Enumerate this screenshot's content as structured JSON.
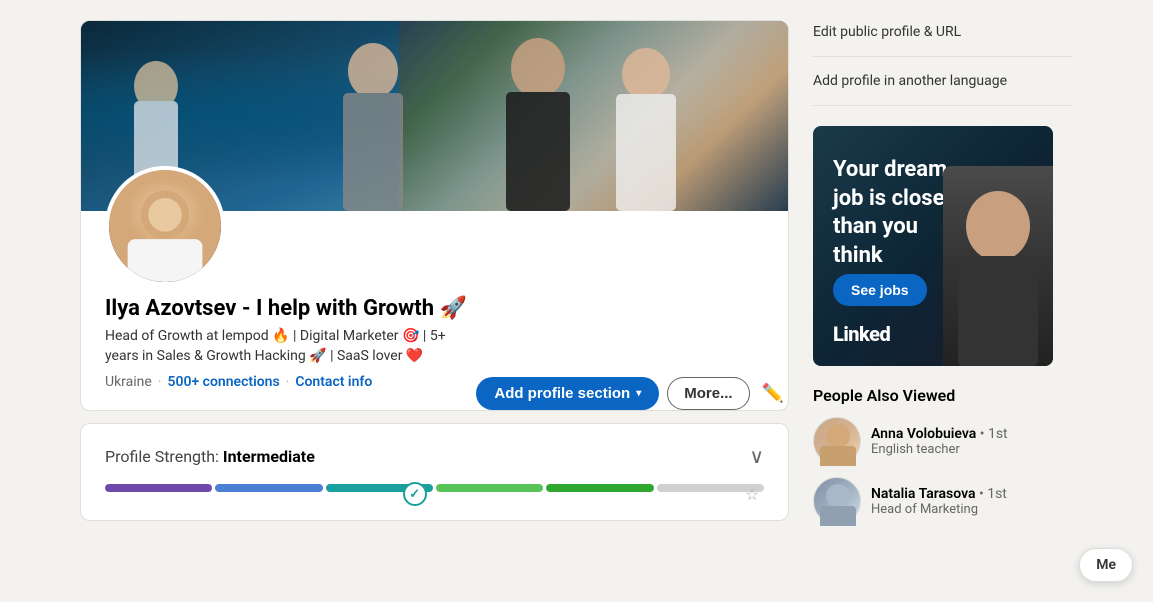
{
  "sidebar": {
    "edit_profile_link": "Edit public profile & URL",
    "add_language_link": "Add profile in another language"
  },
  "ad": {
    "text": "Your dream job is closer than you think",
    "button_label": "See jobs",
    "logo": "Linked"
  },
  "people_also_viewed": {
    "title": "People Also Viewed",
    "people": [
      {
        "name": "Anna Volobuieva",
        "degree": "• 1st",
        "title": "English teacher"
      },
      {
        "name": "Natalia Tarasova",
        "degree": "• 1st",
        "title": "Head of Marketing"
      }
    ]
  },
  "profile": {
    "name": "Ilya Azovtsev - I help with Growth 🚀",
    "headline_line1": "Head of Growth at lempod 🔥 | Digital Marketer 🎯 | 5+",
    "headline_line2": "years in Sales & Growth Hacking 🚀 | SaaS lover ❤️",
    "location": "Ukraine",
    "connections": "500+ connections",
    "contact_info": "Contact info",
    "add_section_label": "Add profile section",
    "more_label": "More...",
    "edit_icon": "✏️"
  },
  "strength": {
    "prefix": "Profile Strength:",
    "level": "Intermediate"
  },
  "floating": {
    "label": "Me"
  }
}
